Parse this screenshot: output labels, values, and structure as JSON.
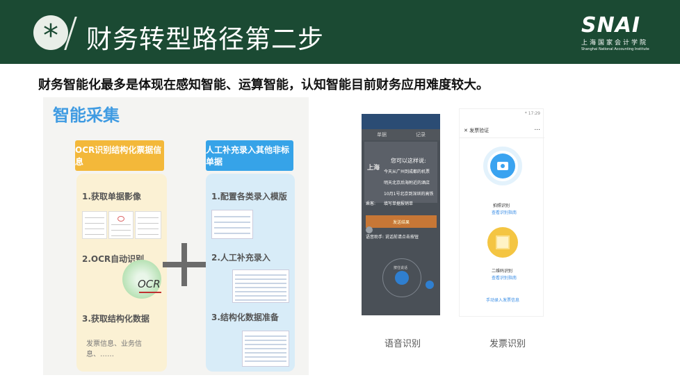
{
  "header": {
    "badge_glyph": "*",
    "title": "财务转型路径第二步",
    "logo_mark": "SNAI",
    "logo_cn": "上海国家会计学院",
    "logo_en": "Shanghai National Accounting Institute",
    "bg_color": "#1b4a33"
  },
  "subtitle": "财务智能化最多是体现在感知智能、运算智能，认知智能目前财务应用难度较大。",
  "left_figure": {
    "section_title": "智能采集",
    "panel1": {
      "header": "OCR识别结构化票据信息",
      "steps": [
        "1.获取单据影像",
        "2.OCR自动识别",
        "3.获取结构化数据"
      ],
      "ocr_label": "OCR",
      "extra": "发票信息、业务信息、……"
    },
    "panel2": {
      "header": "人工补充录入其他非标单据",
      "steps": [
        "1.配置各类录入模版",
        "2.人工补充录入",
        "3.结构化数据准备"
      ]
    },
    "colors": {
      "orange": "#f3b83a",
      "blue": "#36a3e8",
      "title": "#3f9be2"
    }
  },
  "phone_voice": {
    "tabs": [
      "单据",
      "记录"
    ],
    "city": "上海",
    "prompt_title": "您可以这样说:",
    "suggestions": [
      "今天从广州到成都的机票",
      "明天北京后海附近的酒店",
      "10月1号北京到深圳的高铁"
    ],
    "person_label": "乘客:",
    "person_value": "填写单据报销单",
    "button": "发送结果",
    "hint": "语音助手: 说话前请点击按钮",
    "mic_label": "按住说话",
    "caption": "语音识别"
  },
  "phone_invoice": {
    "status": "* 17:29",
    "title": "发票验证",
    "menu": "...",
    "options": [
      {
        "label": "拍照识别",
        "sub": "查看识别指南"
      },
      {
        "label": "二维码识别",
        "sub": "查看识别指南"
      }
    ],
    "manual": "手动录入发票信息",
    "caption": "发票识别"
  }
}
